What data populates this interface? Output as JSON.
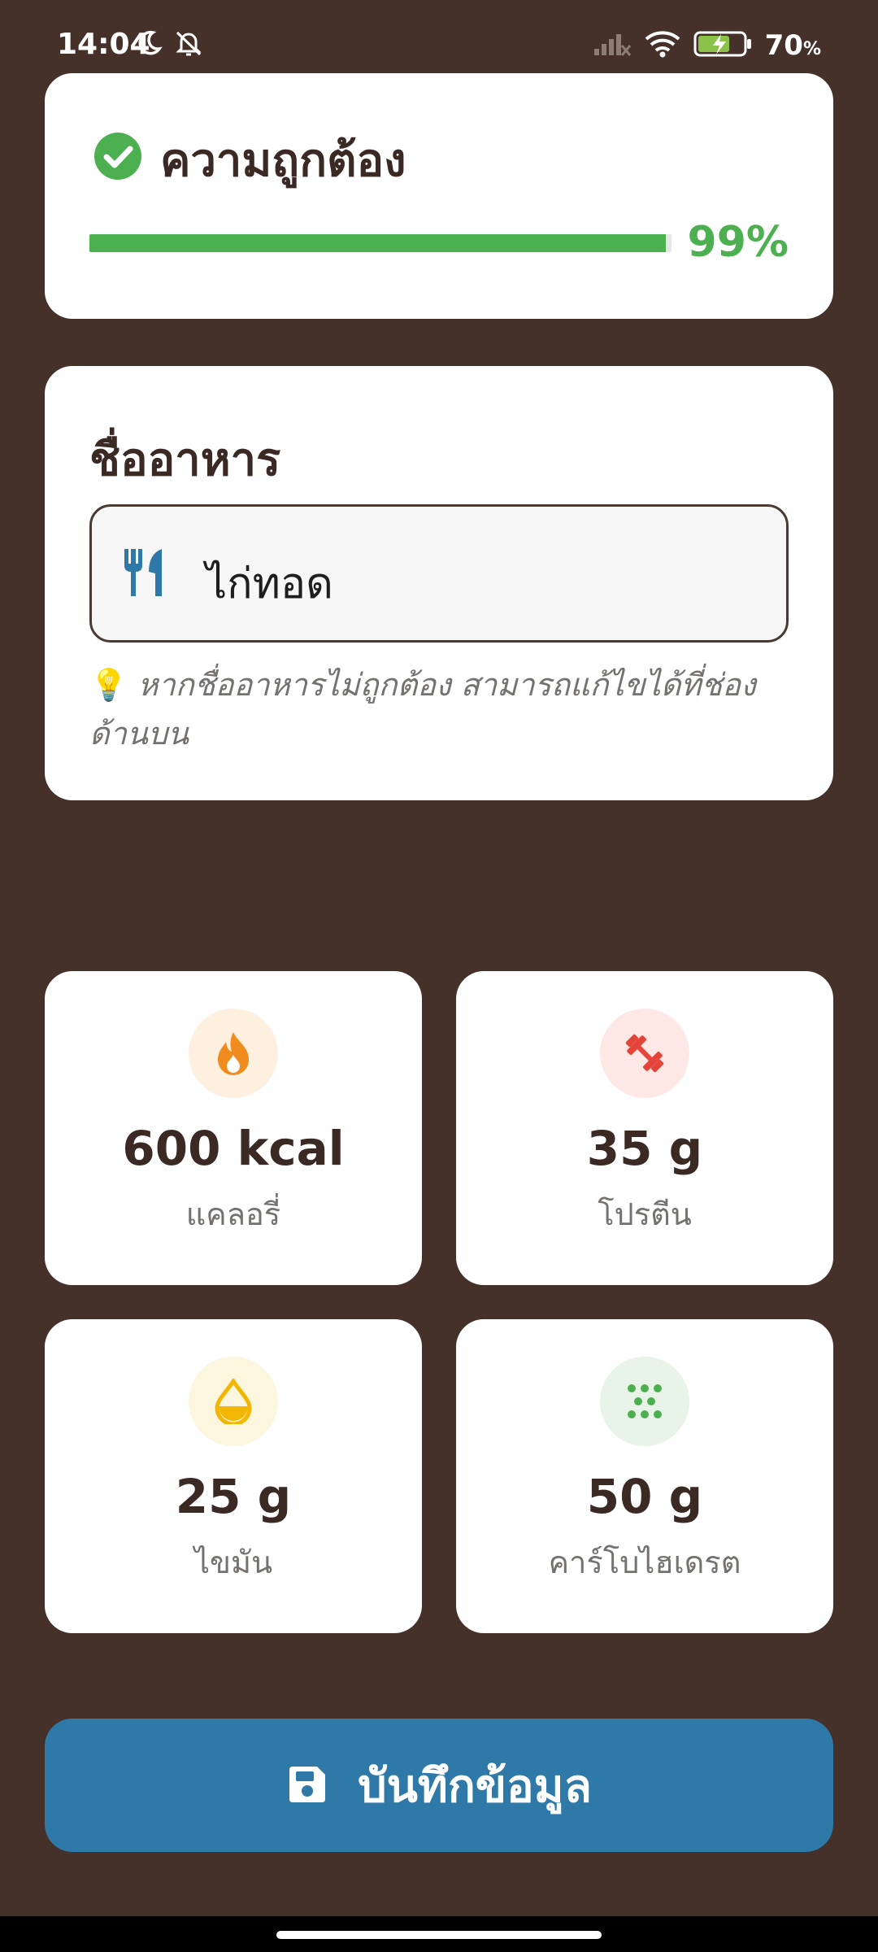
{
  "status_bar": {
    "time": "14:04",
    "battery_percent": "70",
    "battery_unit": "%",
    "icons": [
      "moon-icon",
      "bell-off-icon",
      "signal-icon",
      "wifi-icon",
      "battery-charging-icon"
    ]
  },
  "accuracy": {
    "title": "ความถูกต้อง",
    "value_fraction": 0.99,
    "percent_label": "99%",
    "color": "#4caf50"
  },
  "food_name": {
    "title": "ชื่ออาหาร",
    "value": "ไก่ทอด",
    "hint_icon": "💡",
    "hint": "หากชื่ออาหารไม่ถูกต้อง สามารถแก้ไขได้ที่ช่องด้านบน"
  },
  "nutrients": [
    {
      "icon": "fire-icon",
      "value": "600 kcal",
      "label": "แคลอรี่",
      "color": "#f08c1e"
    },
    {
      "icon": "dumbbell-icon",
      "value": "35 g",
      "label": "โปรตีน",
      "color": "#e5443a"
    },
    {
      "icon": "oil-drop-icon",
      "value": "25 g",
      "label": "ไขมัน",
      "color": "#f2b705"
    },
    {
      "icon": "grains-icon",
      "value": "50 g",
      "label": "คาร์โบไฮเดรต",
      "color": "#4caf50"
    }
  ],
  "save_button": {
    "label": "บันทึกข้อมูล",
    "icon": "save-icon",
    "color": "#2f79a8"
  },
  "colors": {
    "background": "#45312a",
    "card": "#ffffff",
    "text": "#3b2a24"
  }
}
